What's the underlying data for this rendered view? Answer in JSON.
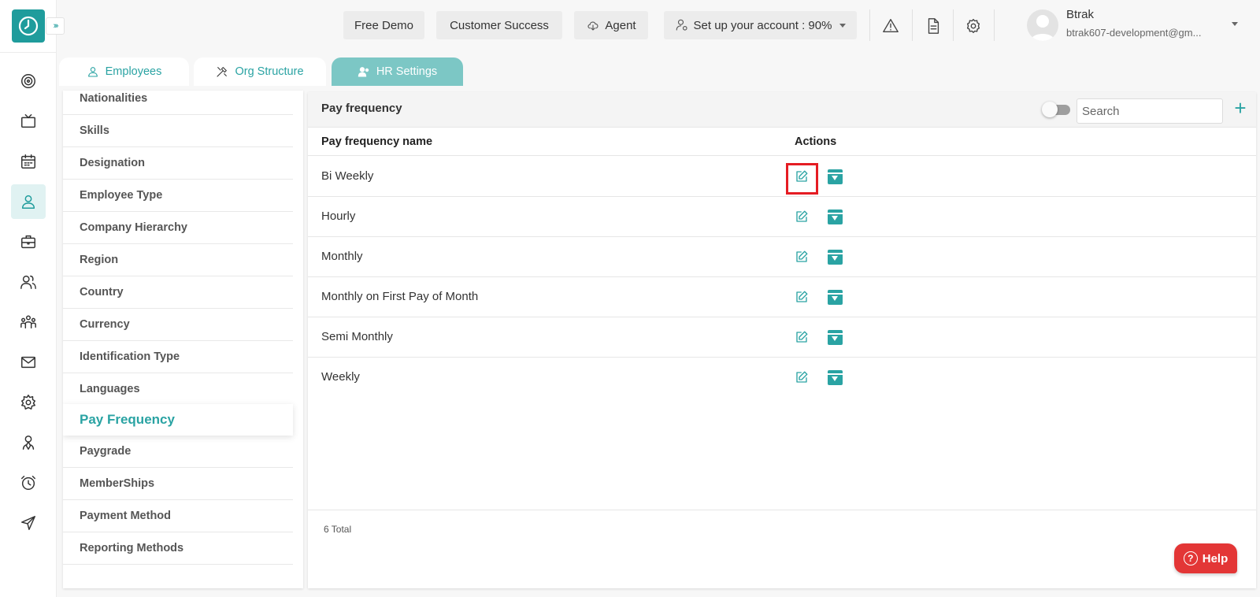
{
  "header": {
    "buttons": {
      "free_demo": "Free Demo",
      "customer_success": "Customer Success",
      "agent": "Agent",
      "setup": "Set up your account : 90%"
    },
    "user": {
      "name": "Btrak",
      "email": "btrak607-development@gm..."
    }
  },
  "tabs": [
    {
      "label": "Employees",
      "icon": "person-icon",
      "active": false
    },
    {
      "label": "Org Structure",
      "icon": "tools-icon",
      "active": false
    },
    {
      "label": "HR Settings",
      "icon": "people-gear-icon",
      "active": true
    }
  ],
  "settings_menu": {
    "items": [
      "Nationalities",
      "Skills",
      "Designation",
      "Employee Type",
      "Company Hierarchy",
      "Region",
      "Country",
      "Currency",
      "Identification Type",
      "Languages",
      "Pay Frequency",
      "Paygrade",
      "MemberShips",
      "Payment Method",
      "Reporting Methods"
    ],
    "active": "Pay Frequency"
  },
  "panel": {
    "title": "Pay frequency",
    "search_placeholder": "Search",
    "add_label": "+",
    "columns": {
      "name": "Pay frequency name",
      "actions": "Actions"
    },
    "rows": [
      "Bi Weekly",
      "Hourly",
      "Monthly",
      "Monthly on First Pay of Month",
      "Semi Monthly",
      "Weekly"
    ],
    "total": "6 Total"
  },
  "help": {
    "label": "Help"
  },
  "colors": {
    "accent": "#2aa3a3",
    "highlight": "#e51c23",
    "help": "#e33636"
  }
}
